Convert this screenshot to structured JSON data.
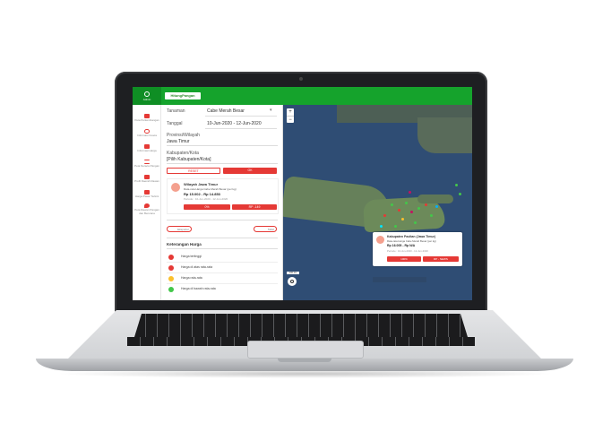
{
  "app": {
    "sidebar_header": "Admin",
    "logo_text": "HitungPangan",
    "sidebar_items": [
      {
        "label": "Peta Perkembangan"
      },
      {
        "label": "Informasi Cuaca"
      },
      {
        "label": "Informasi Harga"
      },
      {
        "label": "Peta Neraca Pangan"
      },
      {
        "label": "Profil Daerah Rawan"
      },
      {
        "label": "Harga Pasar Terkini"
      },
      {
        "label": "Peta Rawan Pangan dan Bencana"
      }
    ]
  },
  "filters": {
    "komoditas_label": "Tanaman",
    "komoditas_value": "Cabe Merah Besar",
    "tanggal_label": "Tanggal",
    "tanggal_value": "10-Jun-2020 - 12-Jun-2020",
    "provinsi_label": "Provinsi/Wilayah",
    "provinsi_value": "Jawa Timur",
    "kabupaten_label": "Kabupaten/Kota",
    "kabupaten_value": "[Pilih Kabupaten/Kota]",
    "reset_label": "RESET",
    "ok_label": "OK"
  },
  "wilayah_card": {
    "title": "Wilayah Jawa Timur",
    "subtitle": "Rata-rata Harga Cabe Merah Besar (per kg)",
    "price": "Rp 15.002 - Rp 14.853",
    "period": "Periode : 10-Jun-2020 - 12-Jun-2020",
    "btn_left": "0%",
    "btn_right": "RP -149"
  },
  "tabs": {
    "left": "Eksporter",
    "right": "Tabel"
  },
  "legend": {
    "title": "Keterangan Harga",
    "items": [
      {
        "label": "Harga tertinggi",
        "color": "#e53935"
      },
      {
        "label": "Harga di atas rata-rata",
        "color": "#e53935"
      },
      {
        "label": "Harga rata-rata",
        "color": "#fbc02d"
      },
      {
        "label": "Harga di bawah rata-rata",
        "color": "#43c74a"
      }
    ]
  },
  "map": {
    "zoom_in": "+",
    "zoom_out": "−",
    "scale_label": "100 km",
    "popup": {
      "title": "Kabupaten Pacitan (Jawa Timur)",
      "subtitle": "Rata-rata Harga Cabe Merah Besar (per kg)",
      "price": "Rp 16.005 - Rp N/A",
      "period": "Periode : 10-Jun-2020 - 12-Jun-2020",
      "btn_left": "100%",
      "btn_right": "RP - NEWS"
    }
  }
}
